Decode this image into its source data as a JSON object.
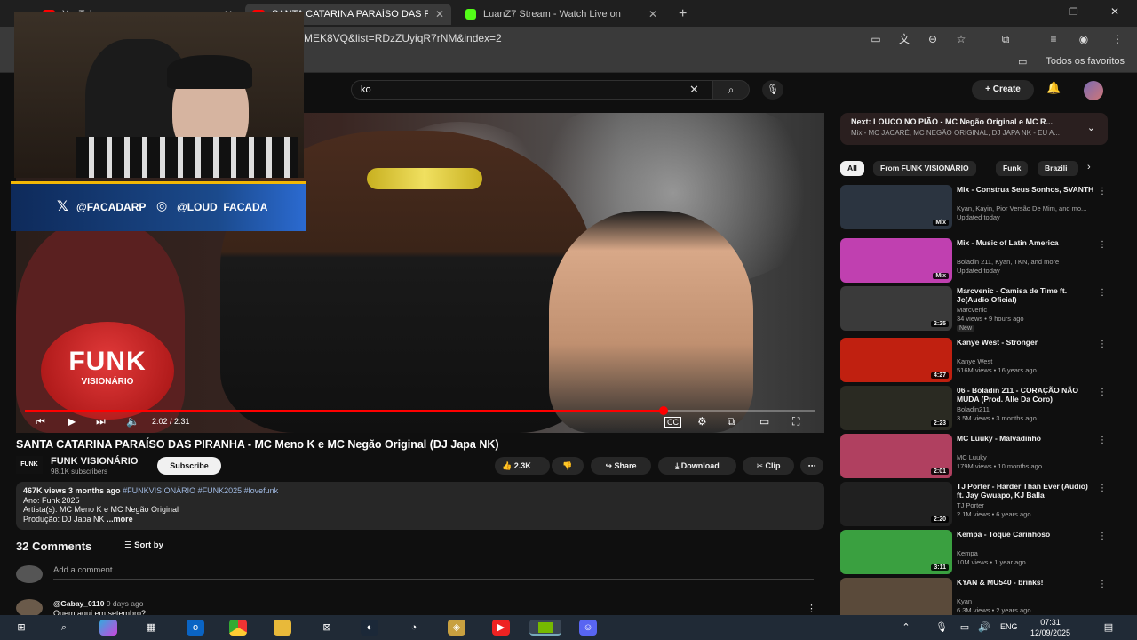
{
  "browser": {
    "tabs": [
      {
        "title": "YouTube",
        "color": "#ff0000"
      },
      {
        "title": "SANTA CATARINA PARAÍSO DAS P",
        "color": "#ff0000"
      },
      {
        "title": "LuanZ7 Stream - Watch Live on",
        "color": "#53fc18"
      }
    ],
    "new_tab": "+",
    "url": "MEK8VQ&list=RDzZUyiqR7rNM&index=2",
    "all_favorites": "Todos os favoritos"
  },
  "youtube": {
    "search_value": "ko",
    "create_label": "Create"
  },
  "player": {
    "time": "2:02 / 2:31",
    "progress": 0.808,
    "logo_main": "FUNK",
    "logo_sub": "VISIONÁRIO"
  },
  "overlay": {
    "twitter": "@FACADARP",
    "instagram": "@LOUD_FACADA"
  },
  "video": {
    "title": "SANTA CATARINA PARAÍSO DAS PIRANHA - MC Meno K e MC Negão Original (DJ Japa NK)",
    "channel_logo": "FUNK",
    "channel": "FUNK VISIONÁRIO",
    "subscribers": "98.1K subscribers",
    "subscribe": "Subscribe",
    "likes": "2.3K",
    "share": "Share",
    "download": "Download",
    "clip": "Clip",
    "desc_meta": "467K views  3 months ago",
    "desc_tags": "#FUNKVISIONÁRIO #FUNK2025 #lovefunk",
    "desc_line1": "Ano: Funk 2025",
    "desc_line2": "Artista(s): MC Meno K e MC Negão Original",
    "desc_line3": "Produção: DJ Japa NK",
    "desc_more": "...more"
  },
  "comments": {
    "count": "32 Comments",
    "sort": "Sort by",
    "placeholder": "Add a comment...",
    "first_user": "@Gabay_0110",
    "first_time": "9 days ago",
    "first_text": "Quem aqui em setembro?"
  },
  "sidebar": {
    "next_title": "Next: LOUCO NO PIÃO - MC Negão Original e MC R...",
    "next_sub": "Mix - MC JACARÉ, MC NEGÃO ORIGINAL, DJ JAPA NK - EU A...",
    "chips": [
      "All",
      "From FUNK VISIONÁRIO",
      "Funk",
      "Brazili"
    ],
    "items": [
      {
        "title": "Mix - Construa Seus Sonhos, SVANTH",
        "channel": "Kyan, Kayin, Pior Versão De Mim, and mo...",
        "meta": "Updated today",
        "badge": "Mix",
        "color": "#2b3440"
      },
      {
        "title": "Mix - Music of Latin America",
        "channel": "Boladin 211, Kyan, TKN, and more",
        "meta": "Updated today",
        "badge": "Mix",
        "color": "#c040b0"
      },
      {
        "title": "Marcvenic - Camisa de Time ft. Jc(Audio Oficial)",
        "channel": "Marcvenic",
        "meta": "34 views • 9 hours ago",
        "badge": "2:25",
        "color": "#3a3a3a",
        "new": "New"
      },
      {
        "title": "Kanye West - Stronger",
        "channel": "Kanye West",
        "meta": "516M views • 16 years ago",
        "badge": "4:27",
        "color": "#c02010"
      },
      {
        "title": "06 - Boladin 211 - CORAÇÃO NÃO MUDA (Prod. Alle Da Coro)",
        "channel": "Boladin211",
        "meta": "3.5M views • 3 months ago",
        "badge": "2:23",
        "color": "#2a2a22"
      },
      {
        "title": "MC Luuky - Malvadinho",
        "channel": "MC Luuky",
        "meta": "179M views • 10 months ago",
        "badge": "2:01",
        "color": "#b04060"
      },
      {
        "title": "TJ Porter - Harder Than Ever (Audio) ft. Jay Gwuapo, KJ Balla",
        "channel": "TJ Porter",
        "meta": "2.1M views • 6 years ago",
        "badge": "2:20",
        "color": "#202020"
      },
      {
        "title": "Kempa - Toque Carinhoso",
        "channel": "Kempa",
        "meta": "10M views • 1 year ago",
        "badge": "3:11",
        "color": "#3aa040"
      },
      {
        "title": "KYAN & MU540 - brinks!",
        "channel": "Kyan",
        "meta": "6.3M views • 2 years ago",
        "badge": "",
        "color": "#5a4a3a"
      }
    ]
  },
  "taskbar": {
    "lang": "ENG",
    "time": "07:31",
    "date": "12/09/2025"
  }
}
